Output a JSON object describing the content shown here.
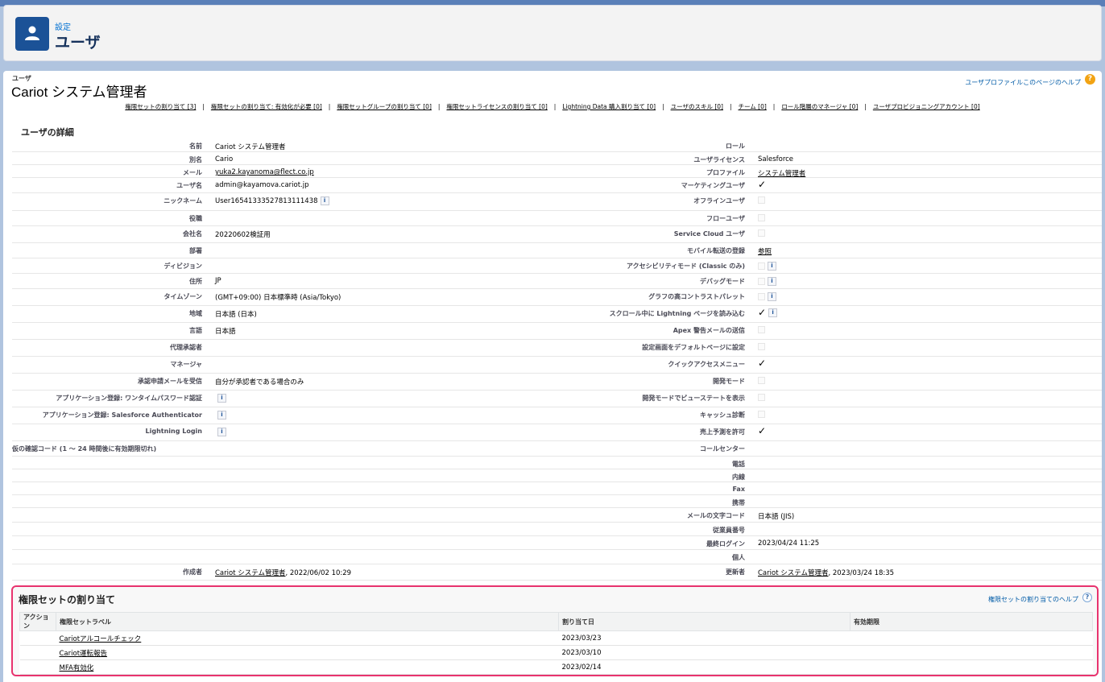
{
  "header": {
    "eyebrow": "設定",
    "title": "ユーザ",
    "icon": "user-icon"
  },
  "record": {
    "object_type": "ユーザ",
    "name": "Cariot システム管理者",
    "help_link": "ユーザプロファイルこのページのヘルプ"
  },
  "related_links": [
    "権限セットの割り当て [3]",
    "権限セットの割り当て: 有効化が必要 [0]",
    "権限セットグループの割り当て [0]",
    "権限セットライセンスの割り当て [0]",
    "Lightning Data 購入割り当て [0]",
    "ユーザのスキル [0]",
    "チーム [0]",
    "ロール階層のマネージャ [0]",
    "ユーザプロビジョニングアカウント [0]"
  ],
  "section_title": "ユーザの詳細",
  "left_fields": [
    {
      "label": "名前",
      "value": "Cariot システム管理者"
    },
    {
      "label": "別名",
      "value": "Cario"
    },
    {
      "label": "メール",
      "value": "yuka2.kayanoma@flect.co.jp"
    },
    {
      "label": "ユーザ名",
      "value": "admin@kayamova.cariot.jp"
    },
    {
      "label": "ニックネーム",
      "value": "User16541333527813111438"
    },
    {
      "label": "役職",
      "value": ""
    },
    {
      "label": "会社名",
      "value": "20220602検証用"
    },
    {
      "label": "部署",
      "value": ""
    },
    {
      "label": "ディビジョン",
      "value": ""
    },
    {
      "label": "住所",
      "value": "JP"
    },
    {
      "label": "タイムゾーン",
      "value": "(GMT+09:00) 日本標準時 (Asia/Tokyo)"
    },
    {
      "label": "地域",
      "value": "日本語 (日本)"
    },
    {
      "label": "言語",
      "value": "日本語"
    },
    {
      "label": "代理承認者",
      "value": ""
    },
    {
      "label": "マネージャ",
      "value": ""
    },
    {
      "label": "承認申請メールを受信",
      "value": "自分が承認者である場合のみ"
    },
    {
      "label": "アプリケーション登録: ワンタイムパスワード認証",
      "value": ""
    },
    {
      "label": "アプリケーション登録: Salesforce Authenticator",
      "value": ""
    },
    {
      "label": "Lightning Login",
      "value": ""
    },
    {
      "label": "仮の確認コード (1 ～ 24 時間後に有効期限切れ)",
      "value": ""
    },
    {
      "label": "作成者",
      "value": "Cariot システム管理者",
      "suffix": ", 2022/06/02 10:29"
    }
  ],
  "right_fields": [
    {
      "label": "ロール",
      "value": ""
    },
    {
      "label": "ユーザライセンス",
      "value": "Salesforce"
    },
    {
      "label": "プロファイル",
      "value": "システム管理者"
    },
    {
      "label": "マーケティングユーザ",
      "checked": true
    },
    {
      "label": "オフラインユーザ",
      "checked": false
    },
    {
      "label": "フローユーザ",
      "checked": false
    },
    {
      "label": "Service Cloud ユーザ",
      "checked": false
    },
    {
      "label": "モバイル転送の登録",
      "value": "参照"
    },
    {
      "label": "アクセシビリティモード (Classic のみ)",
      "checked": false
    },
    {
      "label": "デバッグモード",
      "checked": false
    },
    {
      "label": "グラフの高コントラストパレット",
      "checked": false
    },
    {
      "label": "スクロール中に Lightning ページを読み込む",
      "checked": true
    },
    {
      "label": "Apex 警告メールの送信",
      "checked": false
    },
    {
      "label": "設定画面をデフォルトページに設定",
      "checked": false
    },
    {
      "label": "クイックアクセスメニュー",
      "checked": true
    },
    {
      "label": "開発モード",
      "checked": false
    },
    {
      "label": "開発モードでビューステートを表示",
      "checked": false
    },
    {
      "label": "キャッシュ診断",
      "checked": false
    },
    {
      "label": "売上予測を許可",
      "checked": true
    },
    {
      "label": "コールセンター",
      "value": ""
    },
    {
      "label": "電話",
      "value": ""
    },
    {
      "label": "内線",
      "value": ""
    },
    {
      "label": "Fax",
      "value": ""
    },
    {
      "label": "携帯",
      "value": ""
    },
    {
      "label": "メールの文字コード",
      "value": "日本語 (JIS)"
    },
    {
      "label": "従業員番号",
      "value": ""
    },
    {
      "label": "最終ログイン",
      "value": "2023/04/24 11:25"
    },
    {
      "label": "個人",
      "value": ""
    },
    {
      "label": "更新者",
      "value": "Cariot システム管理者",
      "suffix": ", 2023/03/24 18:35"
    }
  ],
  "permission_sets": {
    "title": "権限セットの割り当て",
    "help": "権限セットの割り当てのヘルプ",
    "columns": [
      "アクション",
      "権限セットラベル",
      "割り当て日",
      "有効期限"
    ],
    "rows": [
      {
        "label": "Cariotアルコールチェック",
        "date": "2023/03/23",
        "expires": ""
      },
      {
        "label": "Cariot運転報告",
        "date": "2023/03/10",
        "expires": ""
      },
      {
        "label": "MFA有効化",
        "date": "2023/02/14",
        "expires": ""
      }
    ]
  }
}
